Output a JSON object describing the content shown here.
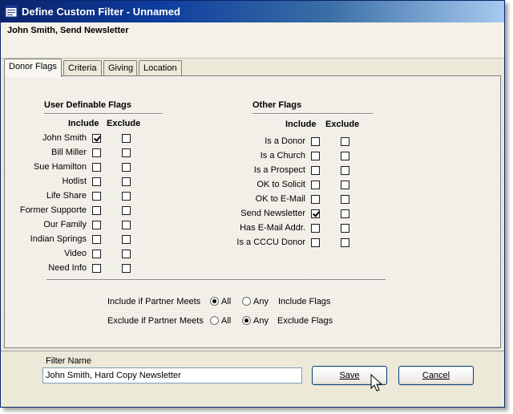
{
  "window": {
    "title": "Define Custom Filter - Unnamed"
  },
  "header": {
    "subject": "John Smith, Send Newsletter"
  },
  "tabs": [
    {
      "label": "Donor Flags",
      "active": true
    },
    {
      "label": "Criteria",
      "active": false
    },
    {
      "label": "Giving",
      "active": false
    },
    {
      "label": "Location",
      "active": false
    }
  ],
  "user_flags": {
    "title": "User Definable Flags",
    "include_header": "Include",
    "exclude_header": "Exclude",
    "items": [
      {
        "label": "John Smith",
        "include": true,
        "exclude": false
      },
      {
        "label": "Bill Miller",
        "include": false,
        "exclude": false
      },
      {
        "label": "Sue Hamilton",
        "include": false,
        "exclude": false
      },
      {
        "label": "Hotlist",
        "include": false,
        "exclude": false
      },
      {
        "label": "Life Share",
        "include": false,
        "exclude": false
      },
      {
        "label": "Former Supporte",
        "include": false,
        "exclude": false
      },
      {
        "label": "Our Family",
        "include": false,
        "exclude": false
      },
      {
        "label": "Indian Springs",
        "include": false,
        "exclude": false
      },
      {
        "label": "Video",
        "include": false,
        "exclude": false
      },
      {
        "label": "Need Info",
        "include": false,
        "exclude": false
      }
    ]
  },
  "other_flags": {
    "title": "Other Flags",
    "include_header": "Include",
    "exclude_header": "Exclude",
    "items": [
      {
        "label": "Is a Donor",
        "include": false,
        "exclude": false
      },
      {
        "label": "Is a Church",
        "include": false,
        "exclude": false
      },
      {
        "label": "Is a Prospect",
        "include": false,
        "exclude": false
      },
      {
        "label": "OK to Solicit",
        "include": false,
        "exclude": false
      },
      {
        "label": "OK to E-Mail",
        "include": false,
        "exclude": false
      },
      {
        "label": "Send Newsletter",
        "include": true,
        "exclude": false
      },
      {
        "label": "Has E-Mail Addr.",
        "include": false,
        "exclude": false
      },
      {
        "label": "Is a CCCU Donor",
        "include": false,
        "exclude": false
      }
    ]
  },
  "match_rules": {
    "include": {
      "label": "Include if Partner Meets",
      "all_label": "All",
      "any_label": "Any",
      "suffix": "Include Flags",
      "selected": "All"
    },
    "exclude": {
      "label": "Exclude if Partner Meets",
      "all_label": "All",
      "any_label": "Any",
      "suffix": "Exclude Flags",
      "selected": "Any"
    }
  },
  "footer": {
    "filter_name_label": "Filter Name",
    "filter_name_value": "John Smith, Hard Copy Newsletter",
    "save_label": "Save",
    "cancel_label": "Cancel"
  },
  "colors": {
    "titlebar_start": "#0a246a",
    "titlebar_end": "#a6caf0",
    "window_face": "#ece9d8"
  },
  "icons": {
    "app": "window-icon",
    "cursor": "mouse-pointer-icon"
  }
}
